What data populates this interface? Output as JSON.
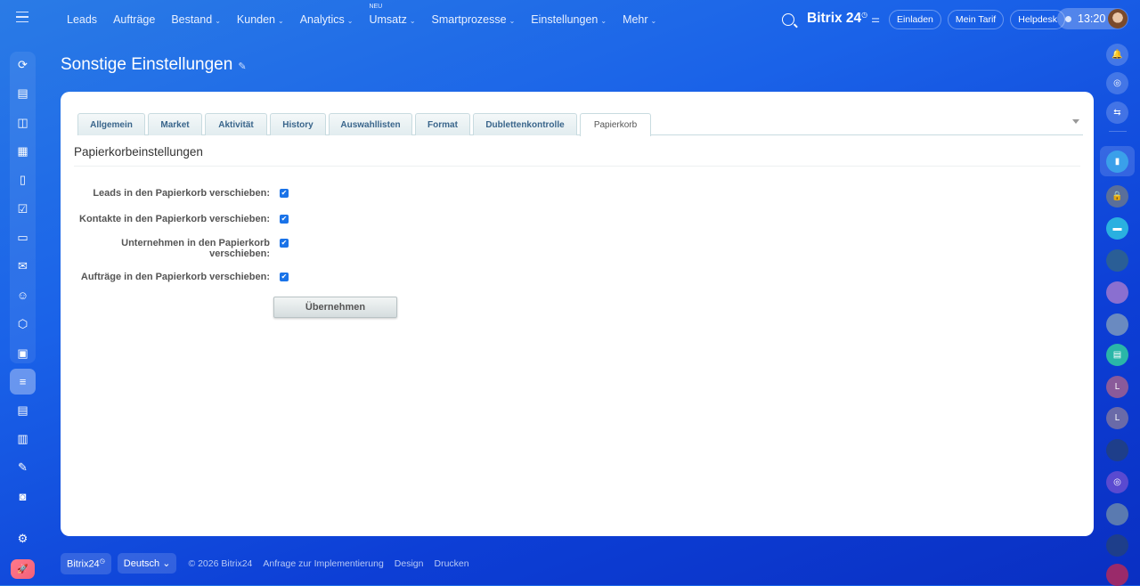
{
  "topbar": {
    "menu_icon": "hamburger-icon",
    "nav": [
      {
        "label": "Leads",
        "chevron": false
      },
      {
        "label": "Aufträge",
        "chevron": false
      },
      {
        "label": "Bestand",
        "chevron": true
      },
      {
        "label": "Kunden",
        "chevron": true
      },
      {
        "label": "Analytics",
        "chevron": true
      },
      {
        "label": "Umsatz",
        "chevron": true,
        "badge": "NEU"
      },
      {
        "label": "Smartprozesse",
        "chevron": true
      },
      {
        "label": "Einstellungen",
        "chevron": true
      },
      {
        "label": "Mehr",
        "chevron": true
      }
    ],
    "logo": "Bitrix 24",
    "buttons": {
      "invite": "Einladen",
      "tariff": "Mein Tarif",
      "helpdesk": "Helpdesk"
    },
    "time": "13:20"
  },
  "page": {
    "title": "Sonstige Einstellungen"
  },
  "tabs": [
    {
      "label": "Allgemein"
    },
    {
      "label": "Market"
    },
    {
      "label": "Aktivität"
    },
    {
      "label": "History"
    },
    {
      "label": "Auswahllisten"
    },
    {
      "label": "Format"
    },
    {
      "label": "Dublettenkontrolle"
    },
    {
      "label": "Papierkorb",
      "active": true
    }
  ],
  "section": {
    "title": "Papierkorbeinstellungen"
  },
  "settings": [
    {
      "label": "Leads in den Papierkorb verschieben:",
      "checked": true
    },
    {
      "label": "Kontakte in den Papierkorb verschieben:",
      "checked": true
    },
    {
      "label": "Unternehmen in den Papierkorb verschieben:",
      "checked": true
    },
    {
      "label": "Aufträge in den Papierkorb verschieben:",
      "checked": true
    }
  ],
  "apply_label": "Übernehmen",
  "footer": {
    "brand": "Bitrix24",
    "language": "Deutsch",
    "copyright": "© 2026 Bitrix24",
    "links": [
      "Anfrage zur Implementierung",
      "Design",
      "Drucken"
    ]
  },
  "right_sidebar": {
    "letters": [
      "L",
      "L"
    ]
  },
  "colors": {
    "accent": "#1a73e8",
    "background": "#1a62e8"
  }
}
